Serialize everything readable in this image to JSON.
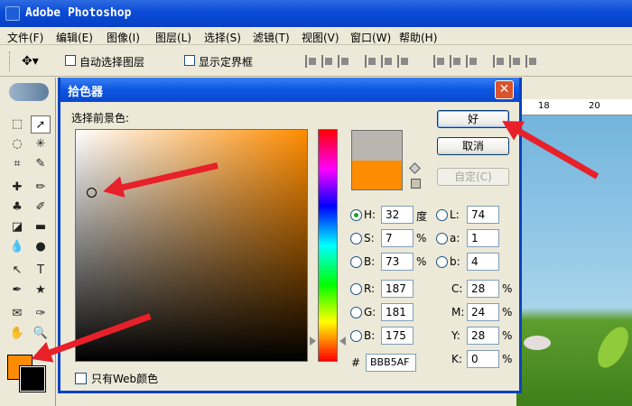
{
  "app": {
    "title": "Adobe Photoshop"
  },
  "menu": [
    "文件(F)",
    "编辑(E)",
    "图像(I)",
    "图层(L)",
    "选择(S)",
    "滤镜(T)",
    "视图(V)",
    "窗口(W)",
    "帮助(H)"
  ],
  "options_bar": {
    "auto_select_label": "自动选择图层",
    "show_bounds_label": "显示定界框"
  },
  "ruler": {
    "ticks": [
      "18",
      "20"
    ]
  },
  "dialog": {
    "title": "拾色器",
    "close": "✕",
    "prompt": "选择前景色:",
    "buttons": {
      "ok": "好",
      "cancel": "取消",
      "custom": "自定(C)"
    },
    "hsb": {
      "h_label": "H:",
      "h_value": "32",
      "h_unit": "度",
      "s_label": "S:",
      "s_value": "7",
      "s_unit": "%",
      "b_label": "B:",
      "b_value": "73",
      "b_unit": "%"
    },
    "rgb": {
      "r_label": "R:",
      "r_value": "187",
      "g_label": "G:",
      "g_value": "181",
      "b_label": "B:",
      "b_value": "175"
    },
    "lab": {
      "l_label": "L:",
      "l_value": "74",
      "a_label": "a:",
      "a_value": "1",
      "b_label": "b:",
      "b_value": "4"
    },
    "cmyk": {
      "c_label": "C:",
      "c_value": "28",
      "m_label": "M:",
      "m_value": "24",
      "y_label": "Y:",
      "y_value": "28",
      "k_label": "K:",
      "k_value": "0",
      "unit": "%"
    },
    "hex_label": "#",
    "hex_value": "BBB5AF",
    "web_only_label": "只有Web颜色"
  },
  "colors": {
    "current_color": "#BBB5AF",
    "hue_color": "#FF8C00",
    "foreground": "#FF8C00",
    "background": "#000000",
    "accent_arrow": "#E8202A"
  },
  "icons": [
    "move-tool-icon",
    "marquee-icon",
    "lasso-icon",
    "crop-icon",
    "brush-icon",
    "stamp-icon",
    "eraser-icon",
    "gradient-icon",
    "blur-icon",
    "pen-icon",
    "type-icon",
    "eyedropper-icon",
    "hand-icon",
    "zoom-icon",
    "out-of-gamut-cube-icon",
    "web-safe-icon"
  ]
}
